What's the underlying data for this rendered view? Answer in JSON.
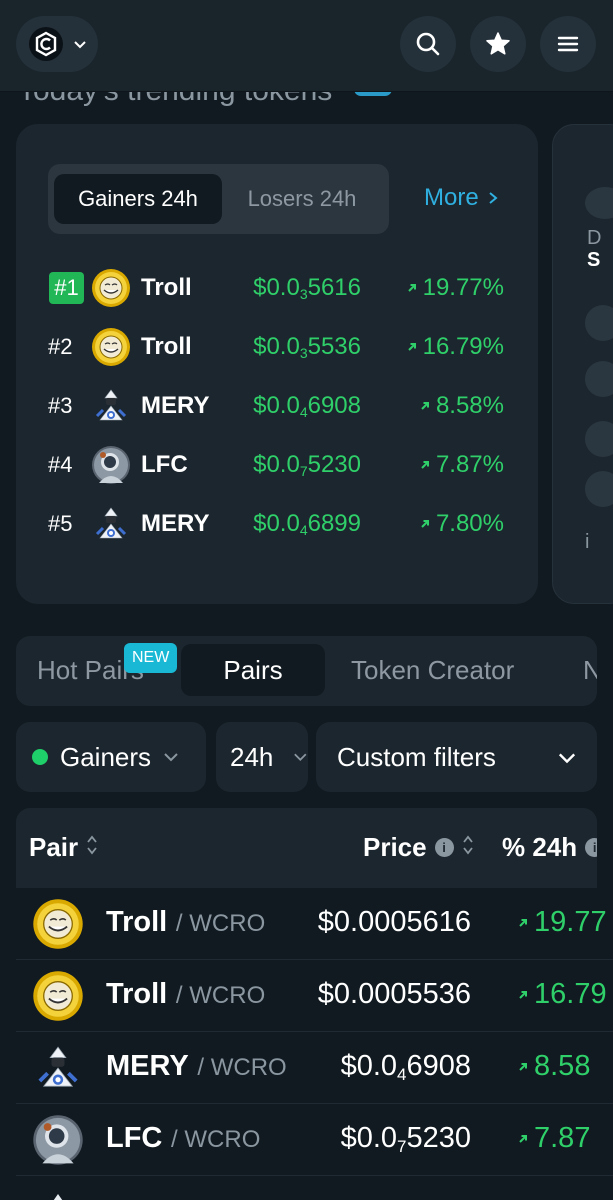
{
  "header": {
    "logo_icon": "cronos-hex-logo",
    "logo_menu_icon": "chevron-down-icon",
    "buttons": [
      {
        "name": "search-button",
        "icon": "search-icon"
      },
      {
        "name": "favorites-button",
        "icon": "star-icon"
      },
      {
        "name": "menu-button",
        "icon": "hamburger-icon"
      }
    ],
    "section_title": "Today's trending tokens"
  },
  "trending": {
    "tabs": {
      "active": "Gainers 24h",
      "inactive": "Losers 24h"
    },
    "more_label": "More",
    "rows": [
      {
        "rank": "#1",
        "token": "Troll",
        "avatar": "troll",
        "price_prefix": "$0.0",
        "price_sub": "3",
        "price_rest": "5616",
        "change": "19.77%"
      },
      {
        "rank": "#2",
        "token": "Troll",
        "avatar": "troll",
        "price_prefix": "$0.0",
        "price_sub": "3",
        "price_rest": "5536",
        "change": "16.79%"
      },
      {
        "rank": "#3",
        "token": "MERY",
        "avatar": "mery",
        "price_prefix": "$0.0",
        "price_sub": "4",
        "price_rest": "6908",
        "change": "8.58%"
      },
      {
        "rank": "#4",
        "token": "LFC",
        "avatar": "lfc",
        "price_prefix": "$0.0",
        "price_sub": "7",
        "price_rest": "5230",
        "change": "7.87%"
      },
      {
        "rank": "#5",
        "token": "MERY",
        "avatar": "mery",
        "price_prefix": "$0.0",
        "price_sub": "4",
        "price_rest": "6899",
        "change": "7.80%"
      }
    ]
  },
  "tabs": {
    "items": [
      "Hot Pairs",
      "Pairs",
      "Token Creator",
      "N"
    ],
    "active": "Pairs",
    "new_badge": "NEW"
  },
  "filters": {
    "gainers": "Gainers",
    "period": "24h",
    "custom": "Custom filters",
    "status_color": "#1fcf6a"
  },
  "table": {
    "headers": {
      "pair": "Pair",
      "price": "Price",
      "change": "% 24h"
    },
    "rows": [
      {
        "base": "Troll",
        "quote": "WCRO",
        "avatar": "troll",
        "price_prefix": "$0.0005616",
        "price_sub": "",
        "price_rest": "",
        "change": "19.77"
      },
      {
        "base": "Troll",
        "quote": "WCRO",
        "avatar": "troll",
        "price_prefix": "$0.0005536",
        "price_sub": "",
        "price_rest": "",
        "change": "16.79"
      },
      {
        "base": "MERY",
        "quote": "WCRO",
        "avatar": "mery",
        "price_prefix": "$0.0",
        "price_sub": "4",
        "price_rest": "6908",
        "change": "8.58"
      },
      {
        "base": "LFC",
        "quote": "WCRO",
        "avatar": "lfc",
        "price_prefix": "$0.0",
        "price_sub": "7",
        "price_rest": "5230",
        "change": "7.87"
      }
    ]
  },
  "colors": {
    "background": "#111a20",
    "card": "#1c262e",
    "positive": "#2fd06a",
    "accent": "#2fb0e0",
    "rank_highlight": "#21b656",
    "new_badge": "#19b9d6"
  }
}
